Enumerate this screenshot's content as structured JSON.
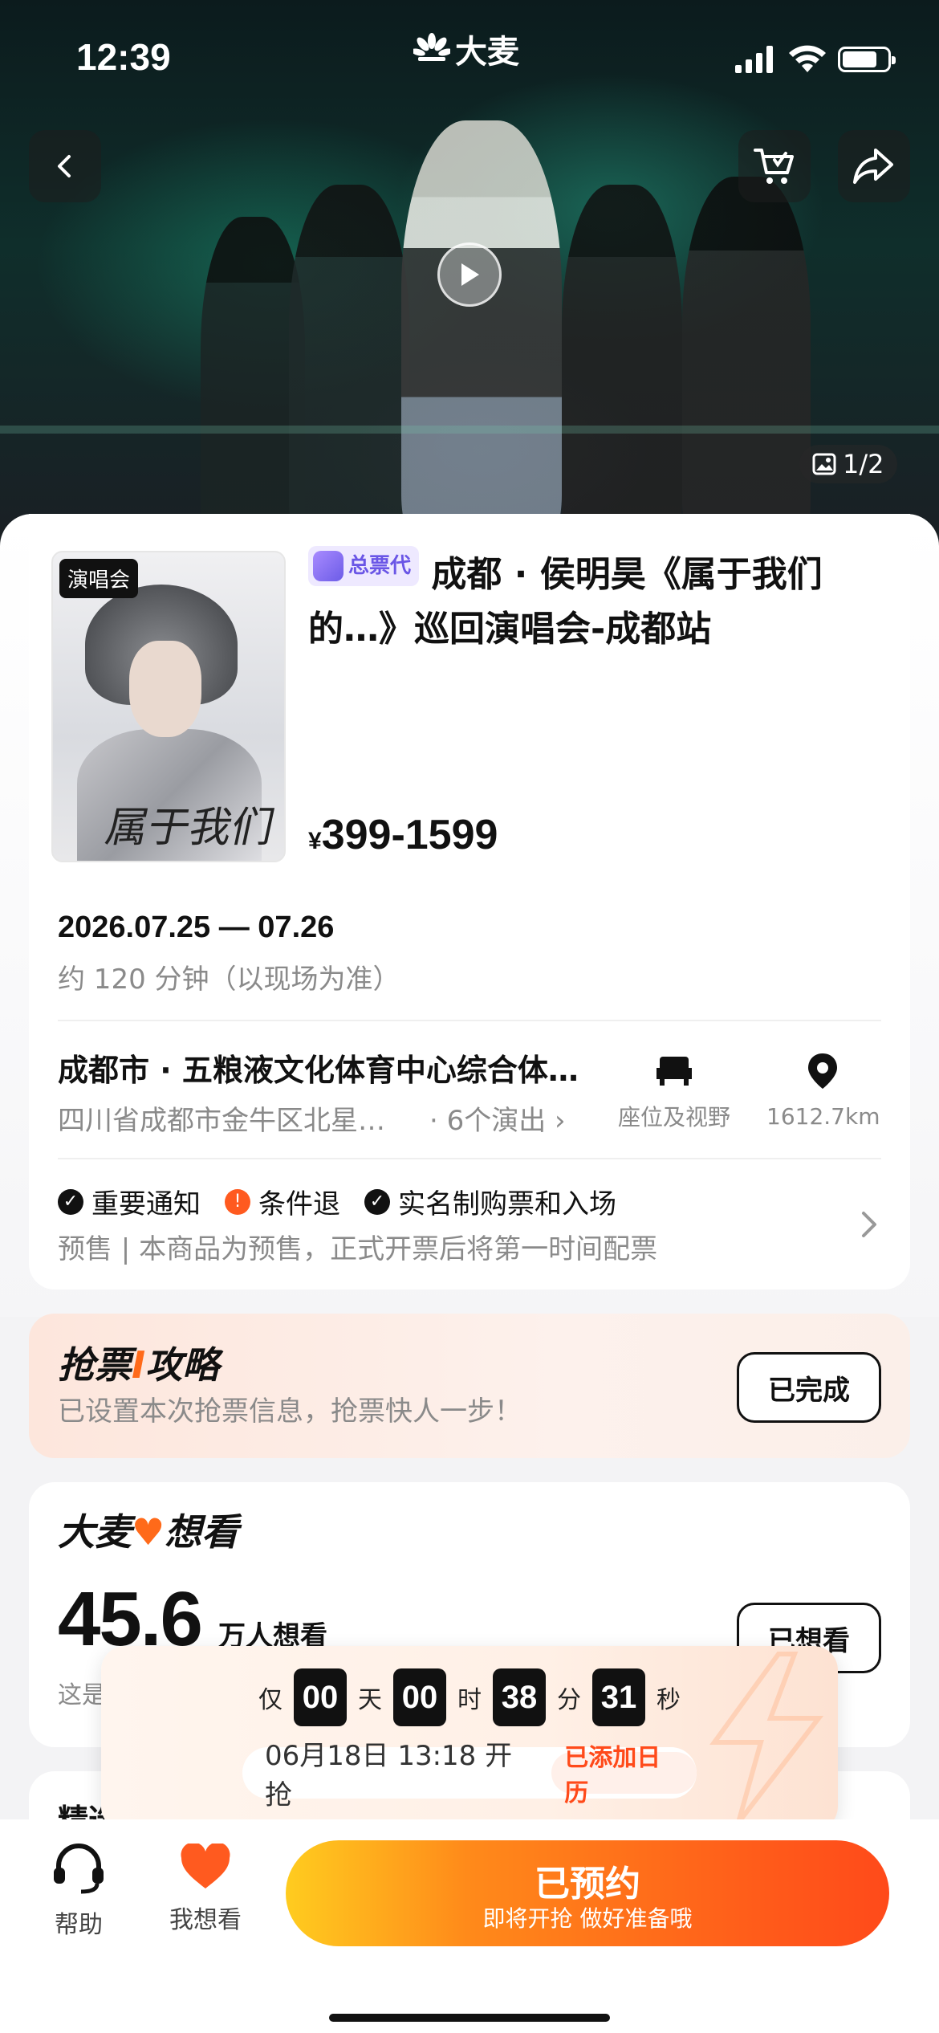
{
  "status_bar": {
    "time": "12:39",
    "brand": "大麦"
  },
  "hero": {
    "media_counter": "1/2"
  },
  "event": {
    "poster_tag": "演唱会",
    "agent_badge": "总票代",
    "title": "成都 · 侯明昊《属于我们的…》巡回演唱会-成都站",
    "price_symbol": "¥",
    "price_range": "399-1599",
    "date_range": "2026.07.25 — 07.26",
    "duration": "约 120 分钟（以现场为准）"
  },
  "venue": {
    "name": "成都市 · 五粮液文化体育中心综合体…",
    "address": "四川省成都市金牛区北星…",
    "shows": "· 6个演出 ›",
    "seat_label": "座位及视野",
    "distance": "1612.7km"
  },
  "notices": {
    "items": [
      "重要通知",
      "条件退",
      "实名制购票和入场"
    ],
    "presale": "预售 | 本商品为预售，正式开票后将第一时间配票"
  },
  "strategy": {
    "title_a": "抢票",
    "title_b": "攻略",
    "subtitle": "已设置本次抢票信息，抢票快人一步！",
    "button": "已完成"
  },
  "want": {
    "title_a": "大麦",
    "title_b": "想看",
    "count": "45.6",
    "unit": "万人想看",
    "desc": "这是",
    "button": "已想看"
  },
  "next_section": {
    "title": "精选",
    "more": "›"
  },
  "countdown": {
    "prefix": "仅",
    "days": "00",
    "days_unit": "天",
    "hours": "00",
    "hours_unit": "时",
    "minutes": "38",
    "minutes_unit": "分",
    "seconds": "31",
    "seconds_unit": "秒",
    "open_time": "06月18日 13:18 开抢",
    "calendar_label": "已添加日历"
  },
  "bottom_bar": {
    "help": "帮助",
    "want": "我想看",
    "reserve_main": "已预约",
    "reserve_sub": "即将开抢 做好准备哦"
  },
  "colors": {
    "accent": "#ff5a1a",
    "brand_purple": "#6a56e6",
    "heart": "#ff5a1f"
  }
}
